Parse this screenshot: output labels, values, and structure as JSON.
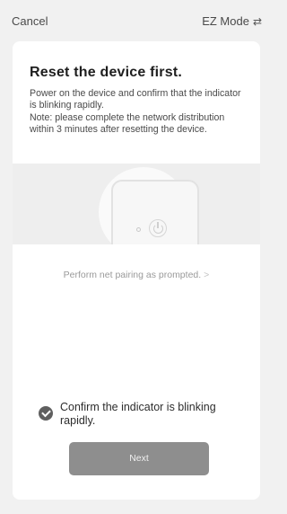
{
  "header": {
    "cancel_label": "Cancel",
    "mode_label": "EZ Mode",
    "mode_icon": "swap-icon"
  },
  "card": {
    "title": "Reset the device first.",
    "description": "Power on the device and confirm that the indicator is blinking rapidly.",
    "note": "Note: please complete the network distribution within 3 minutes after resetting the device.",
    "prompt_link": "Perform net pairing as prompted.",
    "prompt_chevron": ">",
    "confirm_text": "Confirm the indicator is blinking rapidly.",
    "confirm_checked": true,
    "next_label": "Next"
  },
  "colors": {
    "background": "#f1f1f1",
    "card": "#ffffff",
    "button": "#8e8e8e",
    "check": "#5f5f5f"
  }
}
